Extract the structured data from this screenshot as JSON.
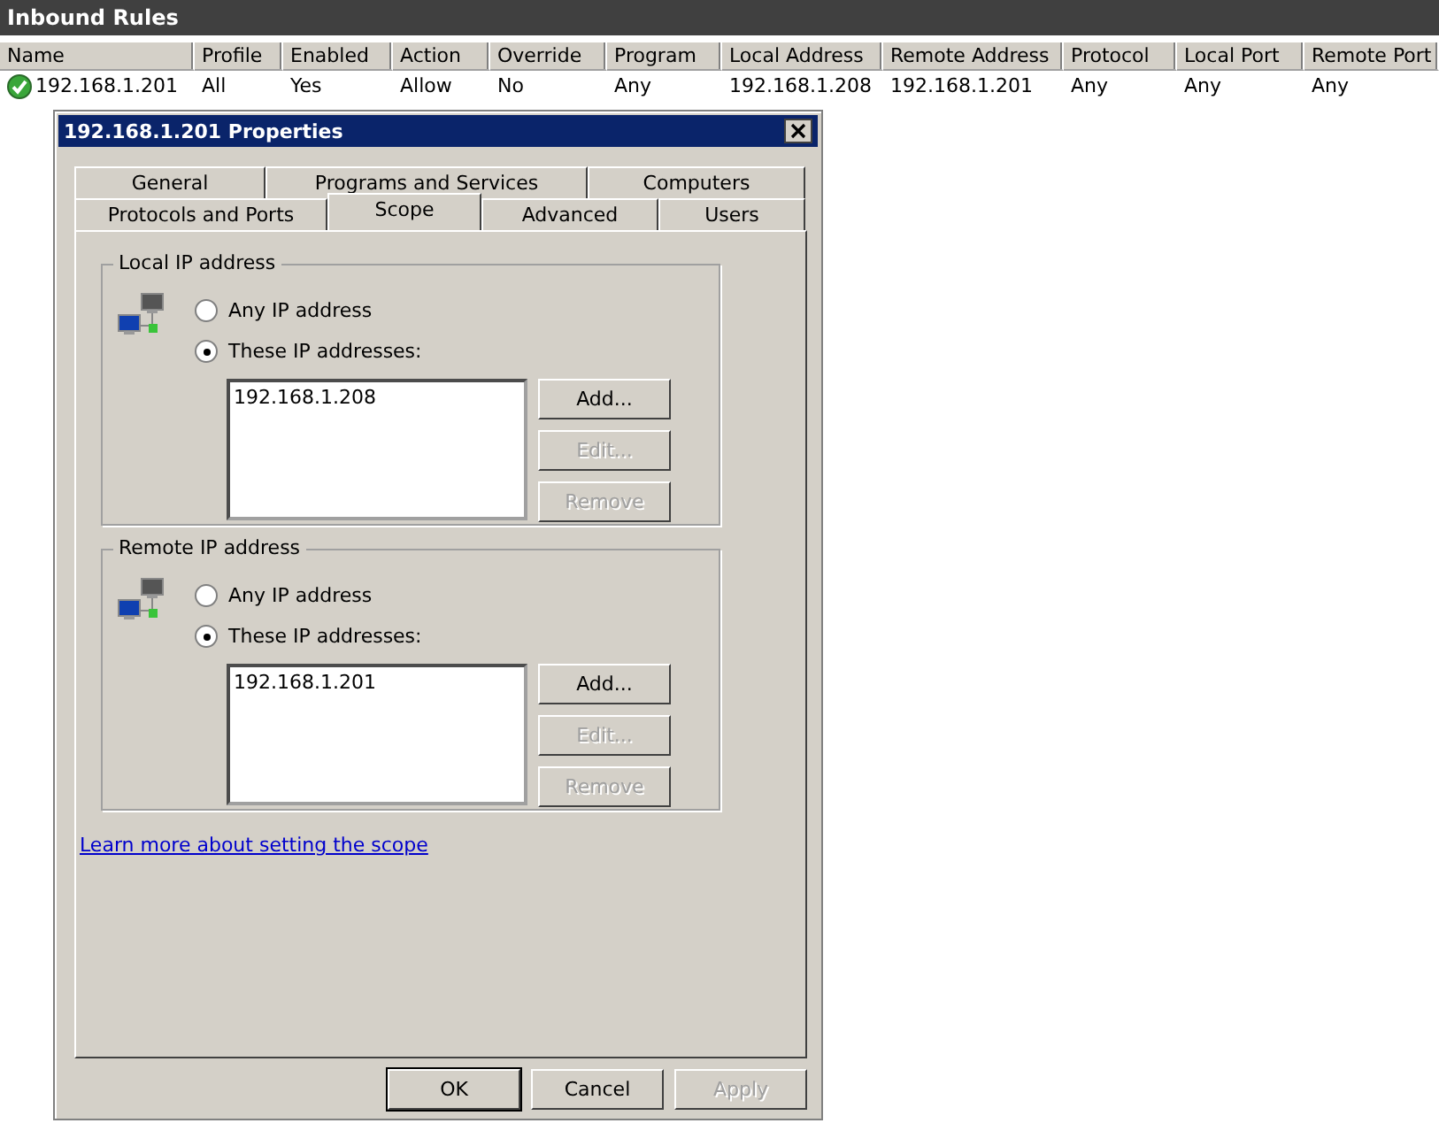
{
  "panel": {
    "title": "Inbound Rules"
  },
  "table": {
    "columns": [
      "Name",
      "Profile",
      "Enabled",
      "Action",
      "Override",
      "Program",
      "Local Address",
      "Remote Address",
      "Protocol",
      "Local Port",
      "Remote Port"
    ],
    "rows": [
      {
        "enabled": true,
        "cells": [
          "192.168.1.201",
          "All",
          "Yes",
          "Allow",
          "No",
          "Any",
          "192.168.1.208",
          "192.168.1.201",
          "Any",
          "Any",
          "Any"
        ]
      }
    ]
  },
  "dialog": {
    "title": "192.168.1.201 Properties",
    "tab_rows": [
      [
        {
          "label": "General",
          "selected": false
        },
        {
          "label": "Programs and Services",
          "selected": false
        },
        {
          "label": "Computers",
          "selected": false
        }
      ],
      [
        {
          "label": "Protocols and Ports",
          "selected": false
        },
        {
          "label": "Scope",
          "selected": true
        },
        {
          "label": "Advanced",
          "selected": false
        },
        {
          "label": "Users",
          "selected": false
        }
      ]
    ],
    "groups": [
      {
        "title": "Local IP address",
        "options": [
          {
            "label": "Any IP address",
            "selected": false
          },
          {
            "label": "These IP addresses:",
            "selected": true
          }
        ],
        "addresses": [
          "192.168.1.208"
        ],
        "buttons": [
          {
            "label": "Add...",
            "disabled": false
          },
          {
            "label": "Edit...",
            "disabled": true
          },
          {
            "label": "Remove",
            "disabled": true
          }
        ]
      },
      {
        "title": "Remote IP address",
        "options": [
          {
            "label": "Any IP address",
            "selected": false
          },
          {
            "label": "These IP addresses:",
            "selected": true
          }
        ],
        "addresses": [
          "192.168.1.201"
        ],
        "buttons": [
          {
            "label": "Add...",
            "disabled": false
          },
          {
            "label": "Edit...",
            "disabled": true
          },
          {
            "label": "Remove",
            "disabled": true
          }
        ]
      }
    ],
    "link": "Learn more about setting the scope",
    "buttons": [
      {
        "label": "OK",
        "disabled": false,
        "default": true
      },
      {
        "label": "Cancel",
        "disabled": false,
        "default": false
      },
      {
        "label": "Apply",
        "disabled": true,
        "default": false
      }
    ]
  }
}
